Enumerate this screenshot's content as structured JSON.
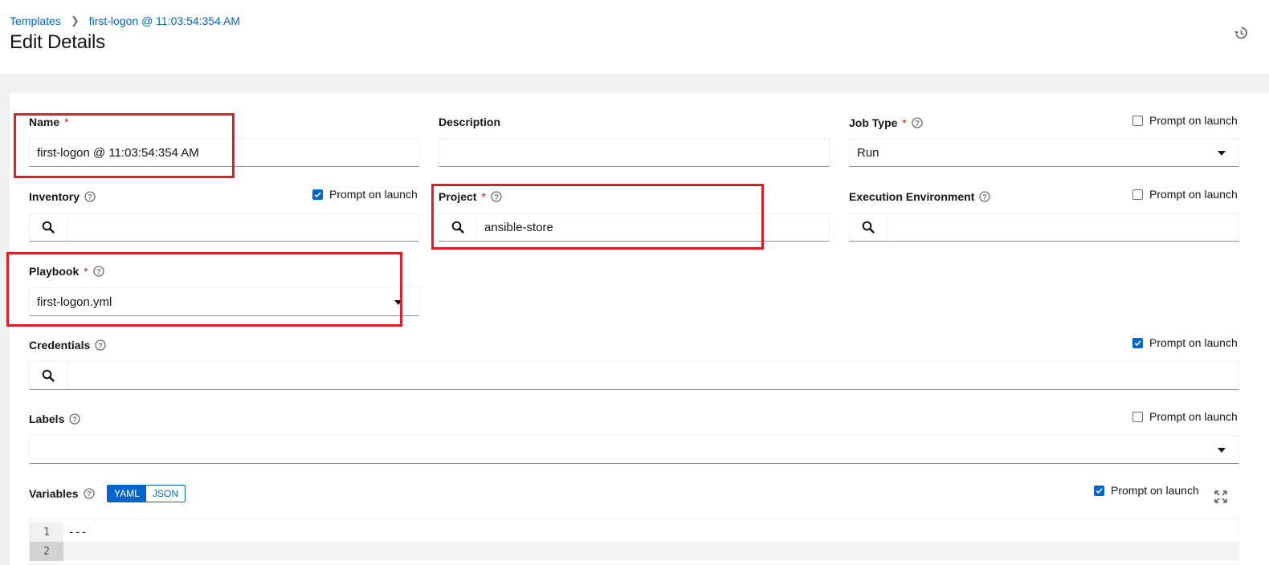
{
  "breadcrumb": {
    "root": "Templates",
    "current": "first-logon @ 11:03:54:354 AM"
  },
  "page": {
    "title": "Edit Details"
  },
  "form": {
    "name": {
      "label": "Name",
      "value": "first-logon @ 11:03:54:354 AM"
    },
    "description": {
      "label": "Description",
      "value": ""
    },
    "job_type": {
      "label": "Job Type",
      "value": "Run",
      "prompt": "Prompt on launch",
      "prompt_checked": false
    },
    "inventory": {
      "label": "Inventory",
      "value": "",
      "prompt": "Prompt on launch",
      "prompt_checked": true
    },
    "project": {
      "label": "Project",
      "value": "ansible-store"
    },
    "execution_environment": {
      "label": "Execution Environment",
      "value": "",
      "prompt": "Prompt on launch",
      "prompt_checked": false
    },
    "playbook": {
      "label": "Playbook",
      "value": "first-logon.yml"
    },
    "credentials": {
      "label": "Credentials",
      "value": "",
      "prompt": "Prompt on launch",
      "prompt_checked": true
    },
    "labels": {
      "label": "Labels",
      "value": "",
      "prompt": "Prompt on launch",
      "prompt_checked": false
    },
    "variables": {
      "label": "Variables",
      "mode_yaml": "YAML",
      "mode_json": "JSON",
      "active_mode": "YAML",
      "prompt": "Prompt on launch",
      "prompt_checked": true,
      "lines": [
        {
          "number": "1",
          "text": "---"
        },
        {
          "number": "2",
          "text": ""
        }
      ]
    }
  },
  "colors": {
    "accent": "#0066cc",
    "required": "#c9190b",
    "annotation": "#e01d24"
  },
  "icons": [
    "history-icon",
    "help-icon",
    "search-icon",
    "caret-down-icon",
    "checkbox-icon",
    "expand-icon"
  ]
}
